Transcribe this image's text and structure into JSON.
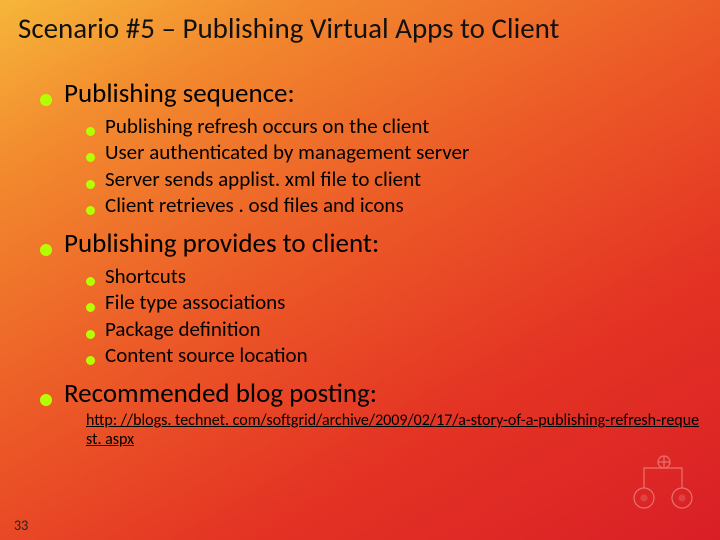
{
  "title": "Scenario #5 – Publishing Virtual Apps to Client",
  "sections": [
    {
      "heading": "Publishing sequence:",
      "items": [
        "Publishing refresh occurs on the client",
        "User authenticated by management server",
        "Server sends applist. xml file to client",
        "Client retrieves . osd files and icons"
      ]
    },
    {
      "heading": "Publishing provides to client:",
      "items": [
        "Shortcuts",
        "File type associations",
        "Package definition",
        "Content source location"
      ]
    },
    {
      "heading": "Recommended blog posting:"
    }
  ],
  "link_text": "http: //blogs. technet. com/softgrid/archive/2009/02/17/a-story-of-a-publishing-refresh-request. aspx",
  "page_number": "33"
}
